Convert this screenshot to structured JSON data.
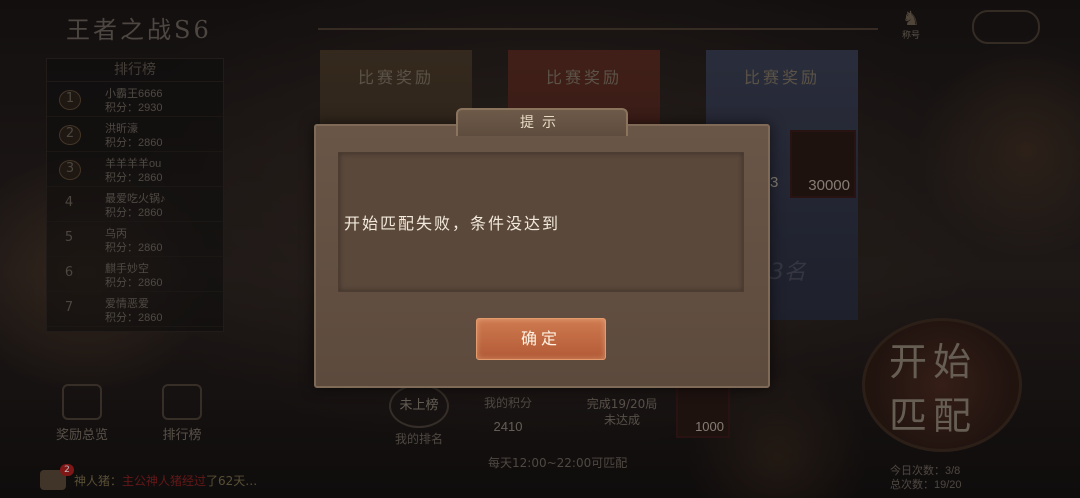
{
  "season_title": "王者之战S6",
  "top_icon_caption": "称号",
  "banners": [
    {
      "title": "比赛奖励"
    },
    {
      "title": "比赛奖励"
    },
    {
      "title": "比赛奖励"
    }
  ],
  "rewards": {
    "item1_qty": "30000",
    "item2_qty": "3",
    "rank_hint": "-3名"
  },
  "rank_panel": {
    "title": "排行榜",
    "rows": [
      {
        "rank": "1",
        "name": "小霸王6666",
        "score": "积分：2930"
      },
      {
        "rank": "2",
        "name": "洪昕濠",
        "score": "积分：2860"
      },
      {
        "rank": "3",
        "name": "羊羊羊羊ou",
        "score": "积分：2860"
      },
      {
        "rank": "4",
        "name": "最爱吃火锅♪",
        "score": "积分：2860"
      },
      {
        "rank": "5",
        "name": "乌丙",
        "score": "积分：2860"
      },
      {
        "rank": "6",
        "name": "麒手妙空",
        "score": "积分：2860"
      },
      {
        "rank": "7",
        "name": "爱情恶爱",
        "score": "积分：2860"
      }
    ]
  },
  "bottom": {
    "awards_label": "奖励总览",
    "rank_label": "排行榜",
    "my_rank_value": "未上榜",
    "my_rank_label": "我的排名",
    "my_score_label": "我的积分",
    "my_score_value": "2410",
    "progress_line1": "完成19/20局",
    "progress_line2": "未达成",
    "progress_reward_qty": "1000",
    "schedule": "每天12:00~22:00可匹配"
  },
  "chat": {
    "badge": "2",
    "who": "神人猪：",
    "highlight": "主公神人猪经过",
    "rest": "了62天…"
  },
  "start_button": {
    "line1": "开始",
    "line2": "匹配"
  },
  "counts": {
    "today": "今日次数：3/8",
    "total": "总次数：19/20"
  },
  "dialog": {
    "title": "提示",
    "message": "开始匹配失败，条件没达到",
    "confirm_label": "确定"
  }
}
